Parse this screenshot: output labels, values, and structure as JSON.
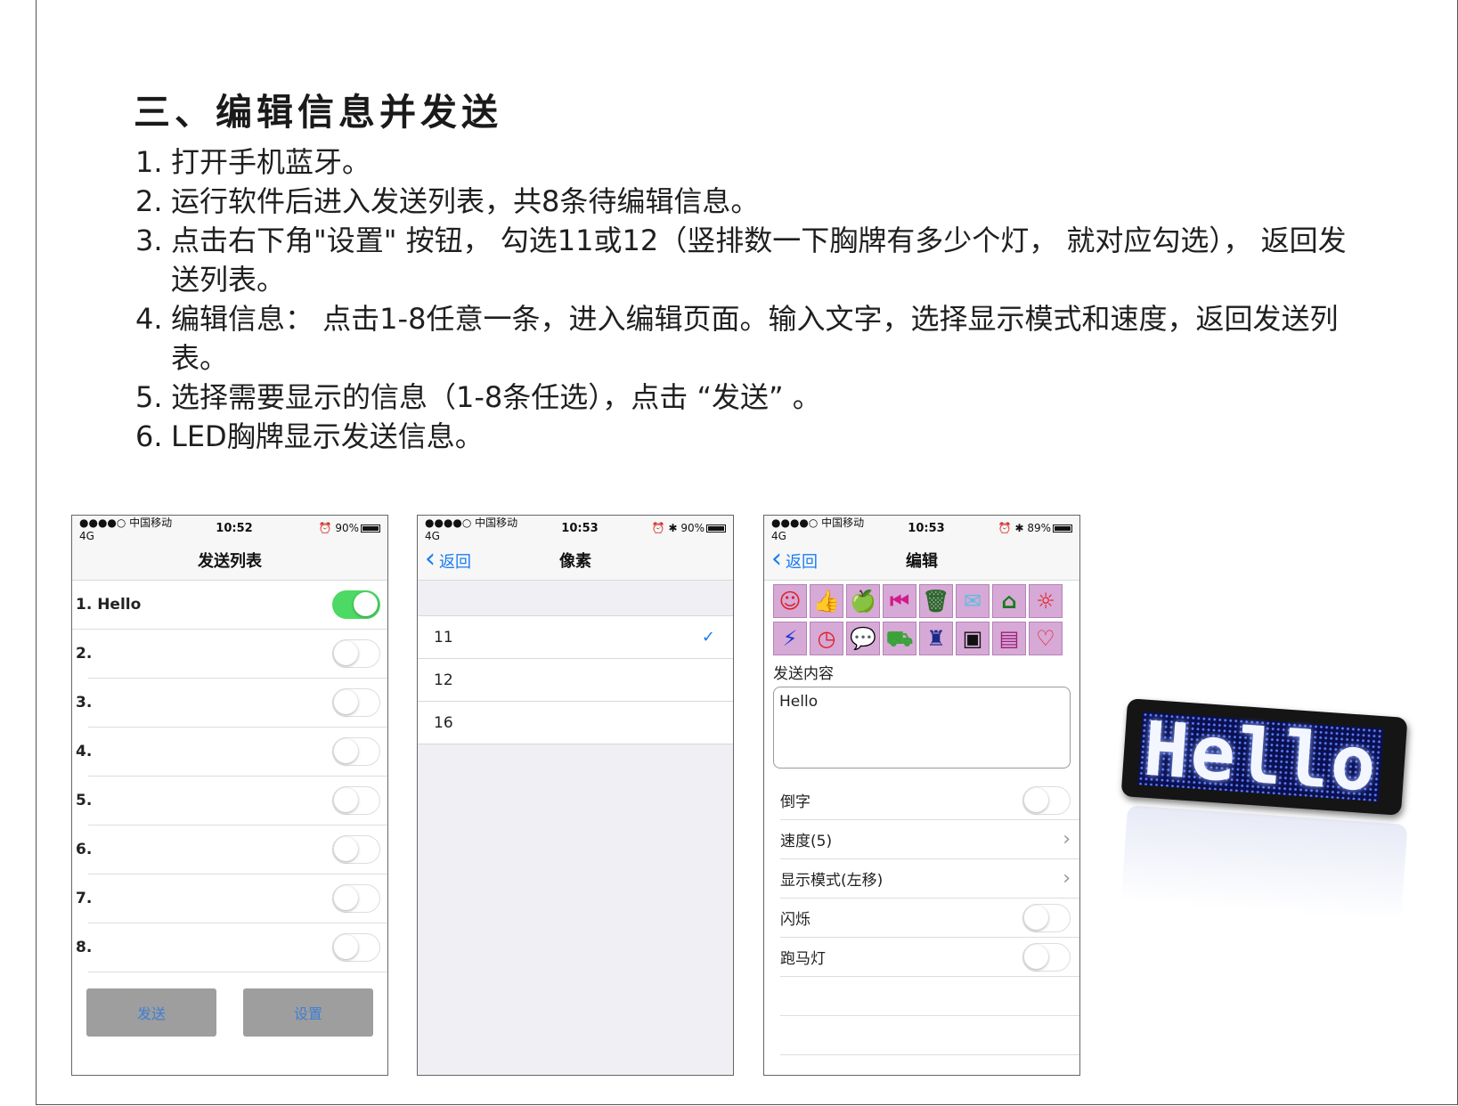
{
  "doc": {
    "title": "三、编辑信息并发送",
    "steps": [
      {
        "num": "1.",
        "text": "打开手机蓝牙。"
      },
      {
        "num": "2.",
        "text": "运行软件后进入发送列表，共8条待编辑信息。"
      },
      {
        "num": "3.",
        "text": "点击右下角\"设置\" 按钮， 勾选11或12（竖排数一下胸牌有多少个灯， 就对应勾选）， 返回发送列表。"
      },
      {
        "num": "4.",
        "text": "编辑信息： 点击1-8任意一条，进入编辑页面。输入文字，选择显示模式和速度，返回发送列表。"
      },
      {
        "num": "5.",
        "text": "选择需要显示的信息（1-8条任选），点击 “发送” 。"
      },
      {
        "num": "6.",
        "text": "LED胸牌显示发送信息。"
      }
    ]
  },
  "phone1": {
    "status": {
      "carrier": "●●●●○ 中国移动  4G",
      "time": "10:52",
      "battery": "90%",
      "battery_level": 0.9
    },
    "nav_title": "发送列表",
    "rows": [
      {
        "label": "1. Hello",
        "on": true
      },
      {
        "label": "2.",
        "on": false
      },
      {
        "label": "3.",
        "on": false
      },
      {
        "label": "4.",
        "on": false
      },
      {
        "label": "5.",
        "on": false
      },
      {
        "label": "6.",
        "on": false
      },
      {
        "label": "7.",
        "on": false
      },
      {
        "label": "8.",
        "on": false
      }
    ],
    "send_label": "发送",
    "settings_label": "设置"
  },
  "phone2": {
    "status": {
      "carrier": "●●●●○ 中国移动  4G",
      "time": "10:53",
      "battery": "90%",
      "battery_level": 0.9
    },
    "back_label": "返回",
    "nav_title": "像素",
    "options": [
      {
        "label": "11",
        "checked": true
      },
      {
        "label": "12",
        "checked": false
      },
      {
        "label": "16",
        "checked": false
      }
    ]
  },
  "phone3": {
    "status": {
      "carrier": "●●●●○ 中国移动  4G",
      "time": "10:53",
      "battery": "89%",
      "battery_level": 0.89
    },
    "back_label": "返回",
    "nav_title": "编辑",
    "icons": [
      {
        "name": "smiley-icon",
        "glyph": "☺",
        "color": "#e0202a"
      },
      {
        "name": "thumbs-up-icon",
        "glyph": "👍",
        "color": "#8a6a1a"
      },
      {
        "name": "apple-icon",
        "glyph": "🍏",
        "color": "#3aa23a"
      },
      {
        "name": "skip-back-icon",
        "glyph": "⏮",
        "color": "#d21a8a"
      },
      {
        "name": "trash-icon",
        "glyph": "🗑",
        "color": "#2a6a2a"
      },
      {
        "name": "mail-icon",
        "glyph": "✉",
        "color": "#55c0e0"
      },
      {
        "name": "home-icon",
        "glyph": "⌂",
        "color": "#1a7a1a"
      },
      {
        "name": "sun-icon",
        "glyph": "☼",
        "color": "#e02020"
      },
      {
        "name": "lightning-icon",
        "glyph": "⚡",
        "color": "#1a3ad0"
      },
      {
        "name": "clock-icon",
        "glyph": "◷",
        "color": "#e02020"
      },
      {
        "name": "chat-icon",
        "glyph": "💬",
        "color": "#1a3ad0"
      },
      {
        "name": "cart-icon",
        "glyph": "⛟",
        "color": "#3aa23a"
      },
      {
        "name": "castle-icon",
        "glyph": "♜",
        "color": "#1a2a8a"
      },
      {
        "name": "computer-icon",
        "glyph": "▣",
        "color": "#111111"
      },
      {
        "name": "floppy-icon",
        "glyph": "▤",
        "color": "#a0207a"
      },
      {
        "name": "heart-icon",
        "glyph": "♡",
        "color": "#e02020"
      }
    ],
    "content_label": "发送内容",
    "content_value": "Hello",
    "rows": [
      {
        "label": "倒字",
        "type": "toggle"
      },
      {
        "label": "速度(5)",
        "type": "arrow"
      },
      {
        "label": "显示模式(左移)",
        "type": "arrow"
      },
      {
        "label": "闪烁",
        "type": "toggle"
      },
      {
        "label": "跑马灯",
        "type": "toggle"
      }
    ],
    "arrow_glyph": "›"
  },
  "badge": {
    "text": "Hello"
  }
}
